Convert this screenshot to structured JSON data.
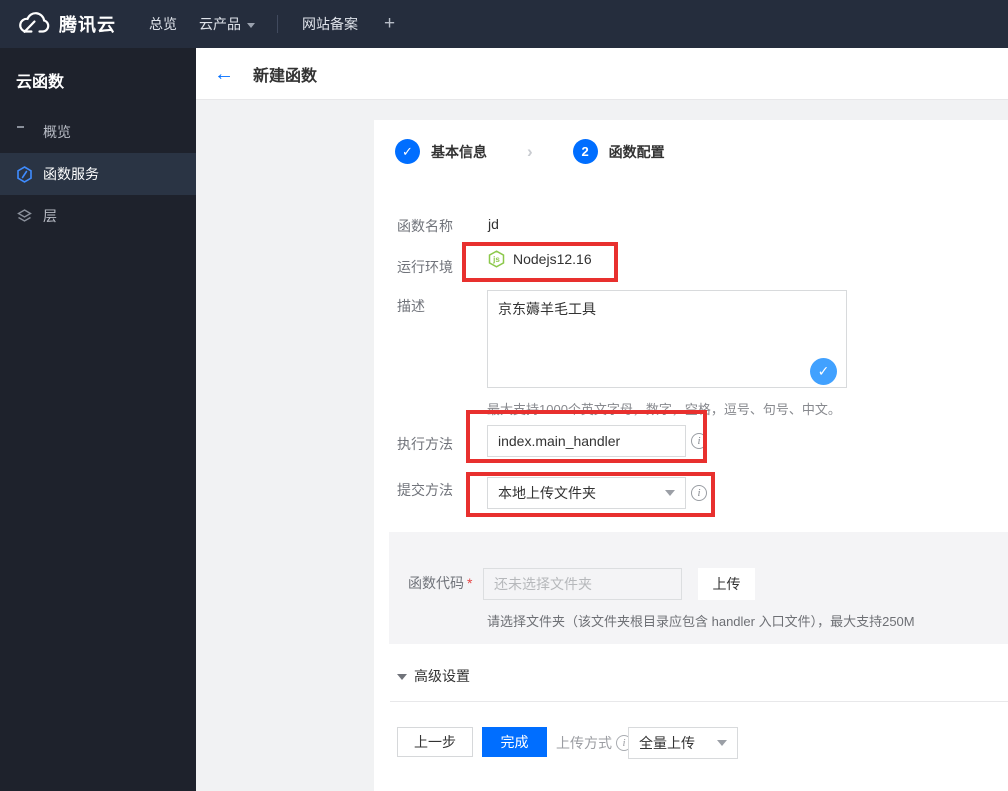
{
  "navbar": {
    "brand": "腾讯云",
    "items": [
      {
        "label": "总览"
      },
      {
        "label": "云产品"
      },
      {
        "label": "网站备案"
      }
    ],
    "plus": "+"
  },
  "sidebar": {
    "title": "云函数",
    "items": [
      {
        "label": "概览",
        "icon": "overview-grid-icon",
        "active": false
      },
      {
        "label": "函数服务",
        "icon": "function-hexagon-icon",
        "active": true
      },
      {
        "label": "层",
        "icon": "layers-icon",
        "active": false
      }
    ]
  },
  "header": {
    "back": "←",
    "title": "新建函数"
  },
  "steps": [
    {
      "number": "1",
      "label": "基本信息",
      "state": "done"
    },
    {
      "number": "2",
      "label": "函数配置",
      "state": "current"
    }
  ],
  "form": {
    "function_name": {
      "label": "函数名称",
      "value": "jd"
    },
    "runtime": {
      "label": "运行环境",
      "value": "Nodejs12.16",
      "icon": "nodejs-icon"
    },
    "description": {
      "label": "描述",
      "value": "京东薅羊毛工具",
      "hint": "最大支持1000个英文字母，数字，空格，逗号、句号、中文。"
    },
    "handler": {
      "label": "执行方法",
      "value": "index.main_handler"
    },
    "submit_method": {
      "label": "提交方法",
      "value": "本地上传文件夹"
    },
    "function_code": {
      "label": "函数代码",
      "required_mark": "*",
      "placeholder": "还未选择文件夹",
      "upload_button": "上传",
      "note": "请选择文件夹（该文件夹根目录应包含 handler 入口文件），最大支持250M"
    },
    "advanced": {
      "label": "高级设置"
    }
  },
  "footer": {
    "prev_button": "上一步",
    "finish_button": "完成",
    "upload_mode_label": "上传方式",
    "upload_mode_value": "全量上传"
  },
  "colors": {
    "accent_blue": "#006eff",
    "check_blue": "#41a1ff",
    "annotation_red": "#e8302e",
    "node_green": "#8cc84b",
    "navbar_bg": "#252d3d",
    "sidebar_bg": "#1e222c",
    "sidebar_active_bg": "#2a3444"
  }
}
